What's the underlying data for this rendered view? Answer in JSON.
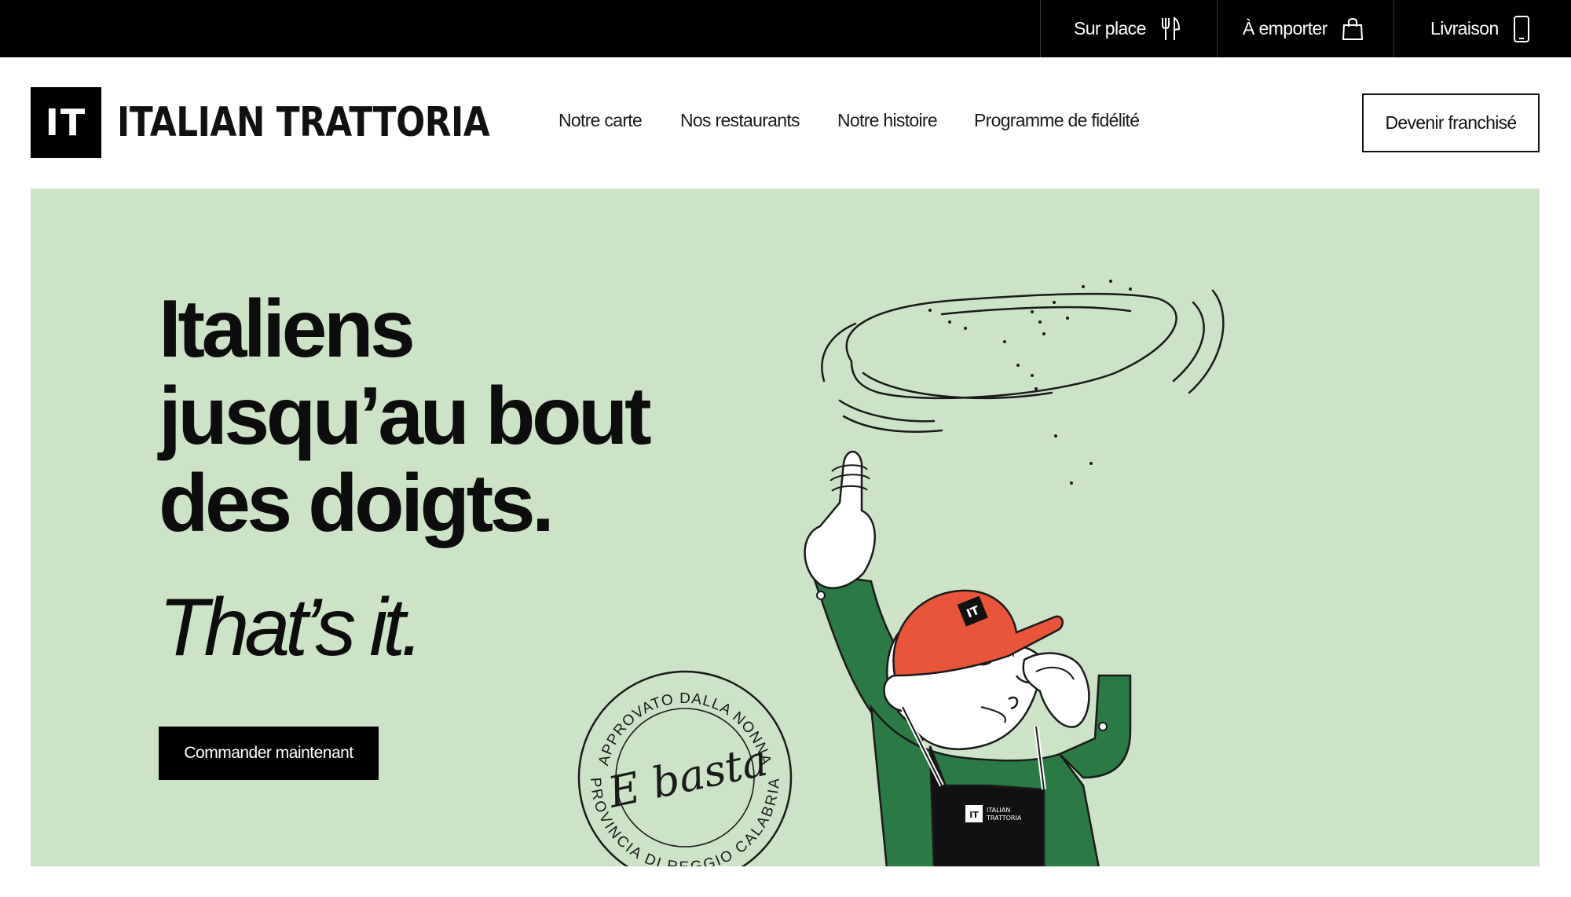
{
  "topbar": {
    "services": [
      {
        "label": "Sur place",
        "icon": "fork-knife-icon"
      },
      {
        "label": "À emporter",
        "icon": "shopping-bag-icon"
      },
      {
        "label": "Livraison",
        "icon": "smartphone-icon"
      }
    ]
  },
  "header": {
    "logo_mark": "IT",
    "logo_text": "ITALIAN TRATTORIA",
    "nav": [
      "Notre carte",
      "Nos restaurants",
      "Notre histoire",
      "Programme de fidélité"
    ],
    "franchise_button": "Devenir franchisé"
  },
  "hero": {
    "headline": [
      "Italiens",
      "jusqu’au bout",
      "des doigts."
    ],
    "tagline": "That’s it.",
    "cta": "Commander maintenant",
    "stamp": {
      "top_arc": "APPROVATO DALLA NONNA",
      "center": "E basta",
      "bottom_arc": "PROVINCIA DI REGGIO CALABRIA"
    },
    "apron_logo_mark": "IT",
    "apron_text": [
      "ITALIAN",
      "TRATTORIA"
    ],
    "cap_logo_mark": "IT"
  },
  "colors": {
    "topbar_bg": "#000000",
    "hero_bg": "#cde3c8",
    "cap_orange": "#e8553a",
    "shirt_green": "#2b7a45",
    "text_dark": "#0d0d0d"
  }
}
